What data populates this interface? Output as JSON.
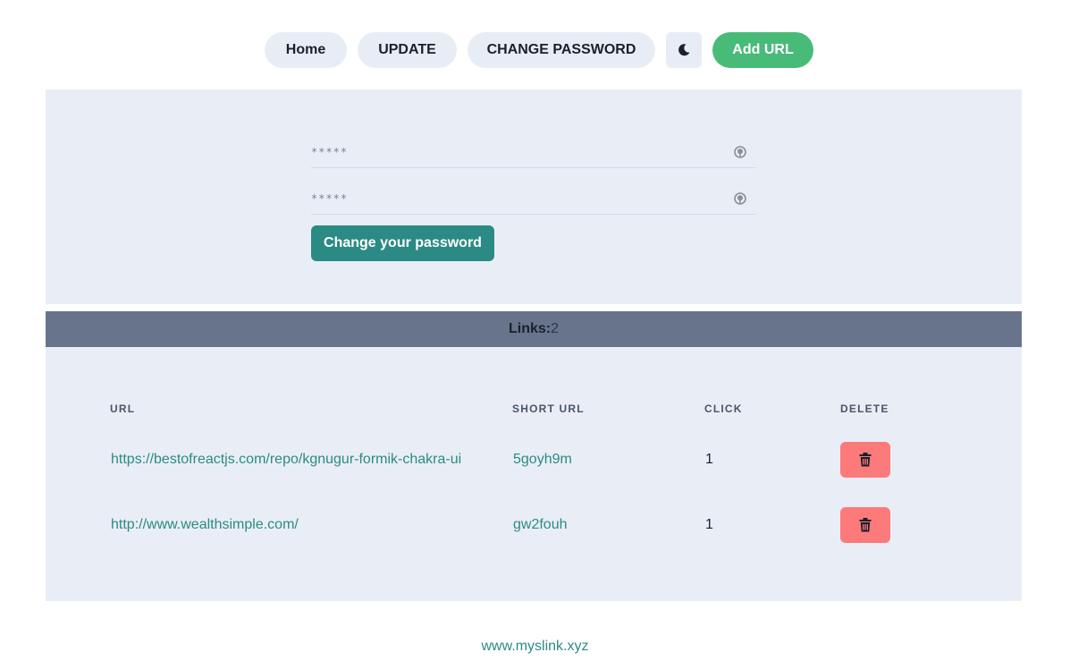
{
  "nav": {
    "home_label": "Home",
    "update_label": "UPDATE",
    "change_password_label": "CHANGE PASSWORD",
    "theme_icon": "moon-icon",
    "add_url_label": "Add URL"
  },
  "password_form": {
    "field1_placeholder": "*****",
    "field2_placeholder": "*****",
    "visibility_icon": "eye-icon",
    "submit_label": "Change your password"
  },
  "links_summary": {
    "label": "Links:",
    "count": "2"
  },
  "table": {
    "headers": [
      "URL",
      "SHORT URL",
      "CLICK",
      "DELETE"
    ],
    "rows": [
      {
        "url": "https://bestofreactjs.com/repo/kgnugur-formik-chakra-ui",
        "short": "5goyh9m",
        "clicks": "1"
      },
      {
        "url": "http://www.wealthsimple.com/",
        "short": "gw2fouh",
        "clicks": "1"
      }
    ],
    "delete_icon": "trash-icon"
  },
  "footer": {
    "link_text": "www.myslink.xyz"
  },
  "colors": {
    "accent_teal": "#2c8a85",
    "add_green": "#48bb78",
    "delete_red": "#fc7a7a",
    "links_bar": "#67748c",
    "panel_bg": "#e9eef6"
  }
}
